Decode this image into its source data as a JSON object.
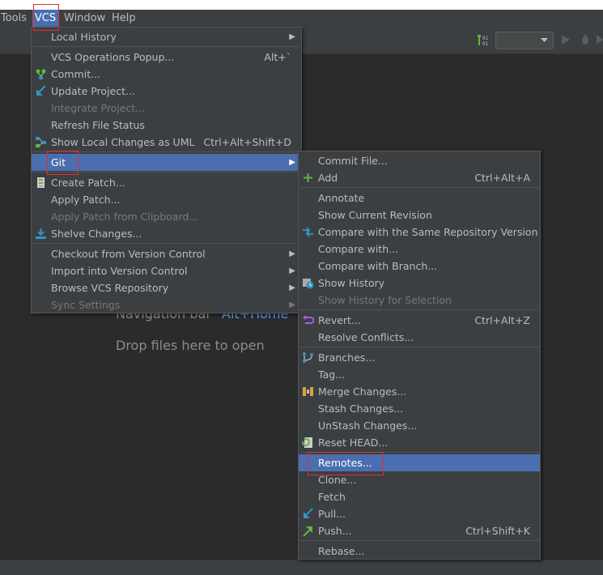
{
  "menubar": [
    {
      "label": "Tools"
    },
    {
      "label": "VCS"
    },
    {
      "label": "Window"
    },
    {
      "label": "Help"
    }
  ],
  "background_hints": {
    "navbar_label": "Navigation bar",
    "navbar_shortcut": "Alt+Home",
    "drop_files": "Drop files here to open"
  },
  "vcs_menu": {
    "items": [
      {
        "label": "Local History",
        "submenu": true
      },
      {
        "label": "VCS Operations Popup...",
        "shortcut": "Alt+`"
      },
      {
        "label": "Commit...",
        "icon": "commit-icon"
      },
      {
        "label": "Update Project...",
        "icon": "update-project-icon"
      },
      {
        "label": "Integrate Project...",
        "disabled": true
      },
      {
        "label": "Refresh File Status"
      },
      {
        "label": "Show Local Changes as UML",
        "shortcut": "Ctrl+Alt+Shift+D",
        "icon": "uml-icon"
      },
      {
        "label": "Git",
        "submenu": true,
        "highlighted": true
      },
      {
        "label": "Create Patch...",
        "icon": "patch-icon"
      },
      {
        "label": "Apply Patch..."
      },
      {
        "label": "Apply Patch from Clipboard...",
        "disabled": true
      },
      {
        "label": "Shelve Changes...",
        "icon": "shelve-icon"
      },
      {
        "label": "Checkout from Version Control",
        "submenu": true
      },
      {
        "label": "Import into Version Control",
        "submenu": true
      },
      {
        "label": "Browse VCS Repository",
        "submenu": true
      },
      {
        "label": "Sync Settings",
        "submenu": true,
        "disabled": true
      }
    ]
  },
  "git_menu": {
    "items": [
      {
        "label": "Commit File..."
      },
      {
        "label": "Add",
        "shortcut": "Ctrl+Alt+A",
        "icon": "add-icon"
      },
      {
        "label": "Annotate"
      },
      {
        "label": "Show Current Revision"
      },
      {
        "label": "Compare with the Same Repository Version",
        "icon": "compare-icon"
      },
      {
        "label": "Compare with..."
      },
      {
        "label": "Compare with Branch..."
      },
      {
        "label": "Show History",
        "icon": "history-icon"
      },
      {
        "label": "Show History for Selection",
        "disabled": true
      },
      {
        "label": "Revert...",
        "shortcut": "Ctrl+Alt+Z",
        "icon": "revert-icon"
      },
      {
        "label": "Resolve Conflicts..."
      },
      {
        "label": "Branches...",
        "icon": "branches-icon"
      },
      {
        "label": "Tag..."
      },
      {
        "label": "Merge Changes...",
        "icon": "merge-icon"
      },
      {
        "label": "Stash Changes..."
      },
      {
        "label": "UnStash Changes..."
      },
      {
        "label": "Reset HEAD...",
        "icon": "reset-head-icon"
      },
      {
        "label": "Remotes...",
        "highlighted": true
      },
      {
        "label": "Clone..."
      },
      {
        "label": "Fetch"
      },
      {
        "label": "Pull...",
        "icon": "pull-icon"
      },
      {
        "label": "Push...",
        "shortcut": "Ctrl+Shift+K",
        "icon": "push-icon"
      },
      {
        "label": "Rebase..."
      }
    ]
  },
  "colors": {
    "background": "#2b2b2b",
    "menu_bg": "#3c3f41",
    "highlight": "#4b6eaf",
    "annotation_red": "#e03030",
    "link_blue": "#589df6"
  }
}
